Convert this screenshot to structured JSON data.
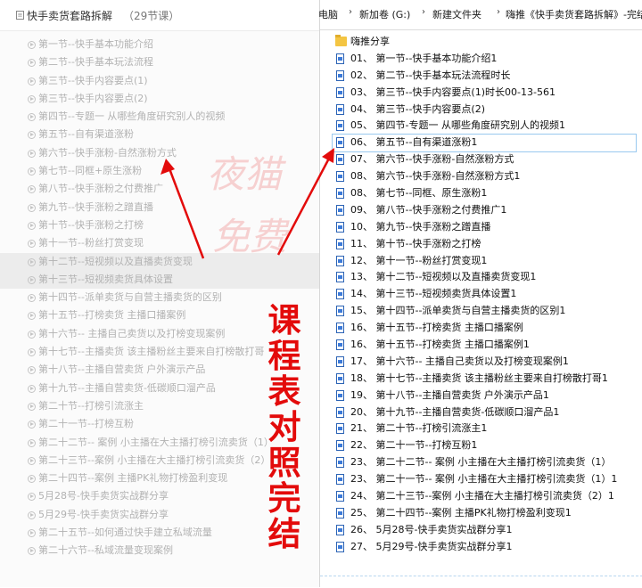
{
  "left_panel": {
    "title": "快手卖货套路拆解",
    "count": "（29节课）",
    "lessons": [
      "第一节--快手基本功能介绍",
      "第二节--快手基本玩法流程",
      "第三节--快手内容要点(1)",
      "第三节--快手内容要点(2)",
      "第四节--专题一 从哪些角度研究别人的视频",
      "第五节--自有渠道涨粉",
      "第六节--快手涨粉-自然涨粉方式",
      "第七节--同框+原生涨粉",
      "第八节--快手涨粉之付费推广",
      "第九节--快手涨粉之蹭直播",
      "第十节--快手涨粉之打榜",
      "第十一节--粉丝打赏变现",
      "第十二节--短视频以及直播卖货变现",
      "第十三节--短视频卖货具体设置",
      "第十四节--派单卖货与自营主播卖货的区别",
      "第十五节--打榜卖货 主播口播案例",
      "第十六节-- 主播自己卖货以及打榜变现案例",
      "第十七节--主播卖货 该主播粉丝主要来自打榜散打哥",
      "第十八节--主播自营卖货 户外演示产品",
      "第十九节--主播自营卖货-低碳顺口溜产品",
      "第二十节--打榜引流涨主",
      "第二十一节--打榜互粉",
      "第二十二节-- 案例 小主播在大主播打榜引流卖货（1）",
      "第二十三节--案例 小主播在大主播打榜引流卖货（2）",
      "第二十四节--案例 主播PK礼物打榜盈利变现",
      "5月28号-快手卖货实战群分享",
      "5月29号-快手卖货实战群分享",
      "第二十五节--如何通过快手建立私域流量",
      "第二十六节--私域流量变现案例"
    ]
  },
  "explorer": {
    "breadcrumbs": [
      "电脑",
      "新加卷 (G:)",
      "新建文件夹",
      "嗨推《快手卖货套路拆解》-完结"
    ],
    "folder_name": "嗨推分享",
    "files": [
      "01、 第一节--快手基本功能介绍1",
      "02、 第二节--快手基本玩法流程时长",
      "03、 第三节--快手内容要点(1)时长00-13-561",
      "04、 第三节--快手内容要点(2)",
      "05、 第四节-专题一 从哪些角度研究别人的视频1",
      "06、 第五节--自有渠道涨粉1",
      "07、 第六节--快手涨粉-自然涨粉方式",
      "08、 第六节--快手涨粉-自然涨粉方式1",
      "08、 第七节--同框、原生涨粉1",
      "09、 第八节--快手涨粉之付费推广1",
      "10、 第九节--快手涨粉之蹭直播",
      "11、 第十节--快手涨粉之打榜",
      "12、 第十一节--粉丝打赏变现1",
      "13、 第十二节--短视频以及直播卖货变现1",
      "14、 第十三节--短视频卖货具体设置1",
      "15、 第十四节--派单卖货与自营主播卖货的区别1",
      "16、 第十五节--打榜卖货 主播口播案例",
      "16、 第十五节--打榜卖货 主播口播案例1",
      "17、 第十六节-- 主播自己卖货以及打榜变现案例1",
      "18、 第十七节--主播卖货 该主播粉丝主要来自打榜散打哥1",
      "19、 第十八节--主播自营卖货 户外演示产品1",
      "20、 第十九节--主播自营卖货-低碳顺口溜产品1",
      "21、 第二十节--打榜引流涨主1",
      "22、 第二十一节--打榜互粉1",
      "23、 第二十二节-- 案例 小主播在大主播打榜引流卖货（1）",
      "23、 第二十一节-- 案例 小主播在大主播打榜引流卖货（1）1",
      "24、 第二十三节--案例 小主播在大主播打榜引流卖货（2）1",
      "25、 第二十四节--案例 主播PK礼物打榜盈利变现1",
      "26、 5月28号-快手卖货实战群分享1",
      "27、 5月29号-快手卖货实战群分享1"
    ]
  },
  "watermark": {
    "text_line1": "夜猫",
    "text_line2": "免费"
  },
  "annotation": {
    "text": "课程表对照完结",
    "color": "#e30b0b"
  },
  "colors": {
    "lesson_text": "#b2b2b2",
    "file_icon_blue": "#2b63b5",
    "folder_yellow": "#f4c542",
    "arrow_red": "#e30b0b"
  }
}
